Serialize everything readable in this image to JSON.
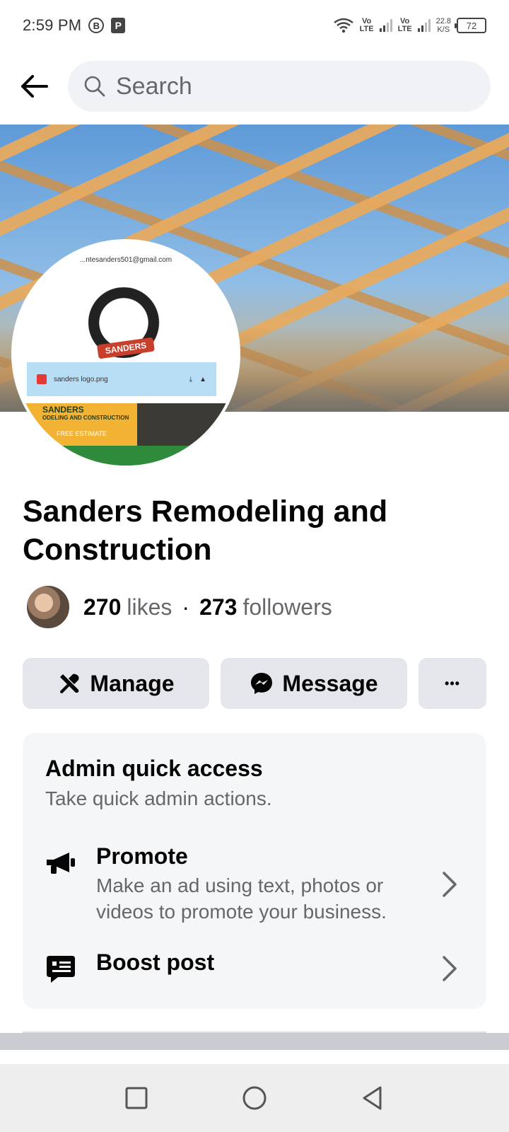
{
  "status_bar": {
    "time": "2:59 PM",
    "badge_b": "B",
    "badge_p": "P",
    "sim1_top": "Vo",
    "sim1_bottom": "LTE",
    "sim2_top": "Vo",
    "sim2_bottom": "LTE",
    "speed_value": "22.8",
    "speed_unit": "K/S",
    "battery": "72"
  },
  "header": {
    "search_placeholder": "Search"
  },
  "profile_image": {
    "email_text": "...ntesanders501@gmail.com",
    "file_name": "sanders logo.png",
    "logo_text": "SANDERS",
    "banner_title": "SANDERS",
    "banner_sub": "ODELING AND CONSTRUCTION",
    "banner_cta": "FREE ESTIMATE"
  },
  "page": {
    "title": "Sanders Remodeling and Construction",
    "likes_count": "270",
    "likes_label": "likes",
    "separator": "·",
    "followers_count": "273",
    "followers_label": "followers"
  },
  "actions": {
    "manage_label": "Manage",
    "message_label": "Message",
    "more_label": "•••"
  },
  "admin": {
    "title": "Admin quick access",
    "subtitle": "Take quick admin actions.",
    "items": [
      {
        "title": "Promote",
        "description": "Make an ad using text, photos or videos to promote your business.",
        "icon": "megaphone-icon"
      },
      {
        "title": "Boost post",
        "description": "",
        "icon": "boost-post-icon"
      }
    ]
  },
  "colors": {
    "accent_bg": "#e4e6eb",
    "card_bg": "#f5f6f7",
    "text_primary": "#050505",
    "text_secondary": "#65676b"
  }
}
